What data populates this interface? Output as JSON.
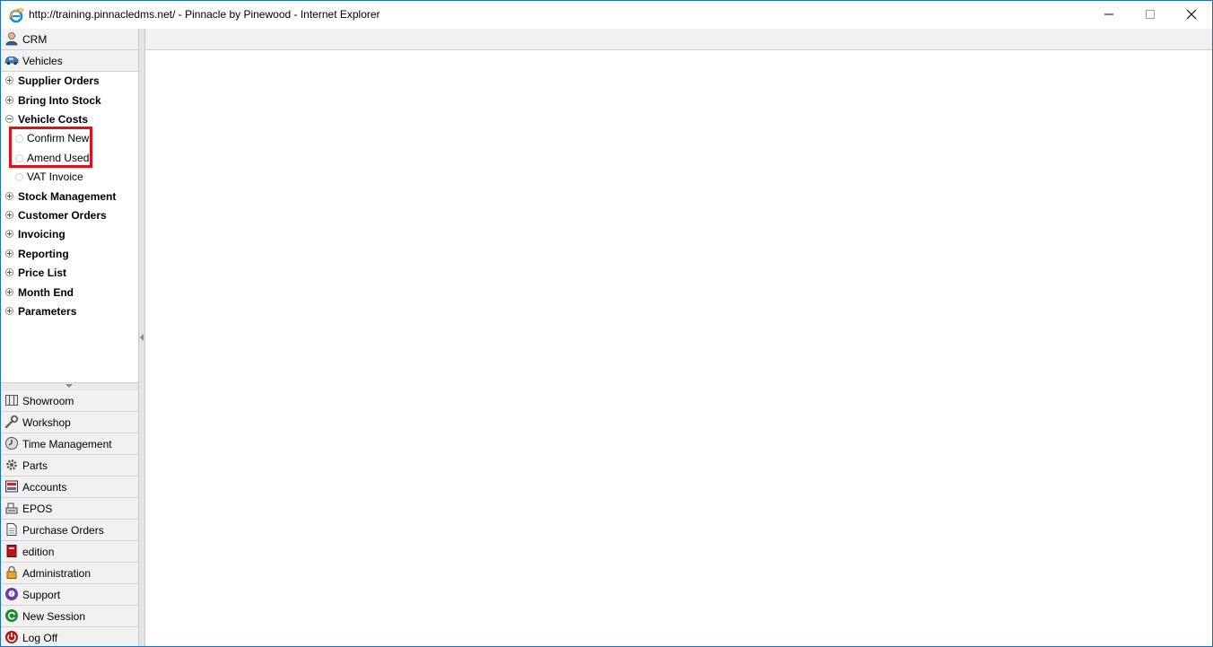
{
  "window": {
    "title": "http://training.pinnacledms.net/ - Pinnacle by Pinewood - Internet Explorer",
    "icon": "internet-explorer-icon"
  },
  "sidebar": {
    "top_headers": [
      {
        "label": "CRM",
        "icon": "user-icon"
      },
      {
        "label": "Vehicles",
        "icon": "car-icon"
      }
    ],
    "tree": [
      {
        "label": "Supplier Orders",
        "expanded": false
      },
      {
        "label": "Bring Into Stock",
        "expanded": false
      },
      {
        "label": "Vehicle Costs",
        "expanded": true,
        "children": [
          {
            "label": "Confirm New"
          },
          {
            "label": "Amend Used"
          },
          {
            "label": "VAT Invoice"
          }
        ]
      },
      {
        "label": "Stock Management",
        "expanded": false
      },
      {
        "label": "Customer Orders",
        "expanded": false
      },
      {
        "label": "Invoicing",
        "expanded": false
      },
      {
        "label": "Reporting",
        "expanded": false
      },
      {
        "label": "Price List",
        "expanded": false
      },
      {
        "label": "Month End",
        "expanded": false
      },
      {
        "label": "Parameters",
        "expanded": false
      }
    ],
    "bottom_items": [
      {
        "label": "Showroom",
        "icon": "showroom-icon"
      },
      {
        "label": "Workshop",
        "icon": "wrench-icon"
      },
      {
        "label": "Time Management",
        "icon": "clock-icon"
      },
      {
        "label": "Parts",
        "icon": "gear-icon"
      },
      {
        "label": "Accounts",
        "icon": "calculator-icon"
      },
      {
        "label": "EPOS",
        "icon": "cash-register-icon"
      },
      {
        "label": "Purchase Orders",
        "icon": "document-icon"
      },
      {
        "label": "edition",
        "icon": "book-icon"
      },
      {
        "label": "Administration",
        "icon": "lock-icon"
      },
      {
        "label": "Support",
        "icon": "support-chat-icon"
      },
      {
        "label": "New Session",
        "icon": "refresh-icon"
      },
      {
        "label": "Log Off",
        "icon": "power-icon"
      }
    ]
  },
  "colors": {
    "highlight": "#e3101a",
    "window_border": "#1e6fc0"
  }
}
